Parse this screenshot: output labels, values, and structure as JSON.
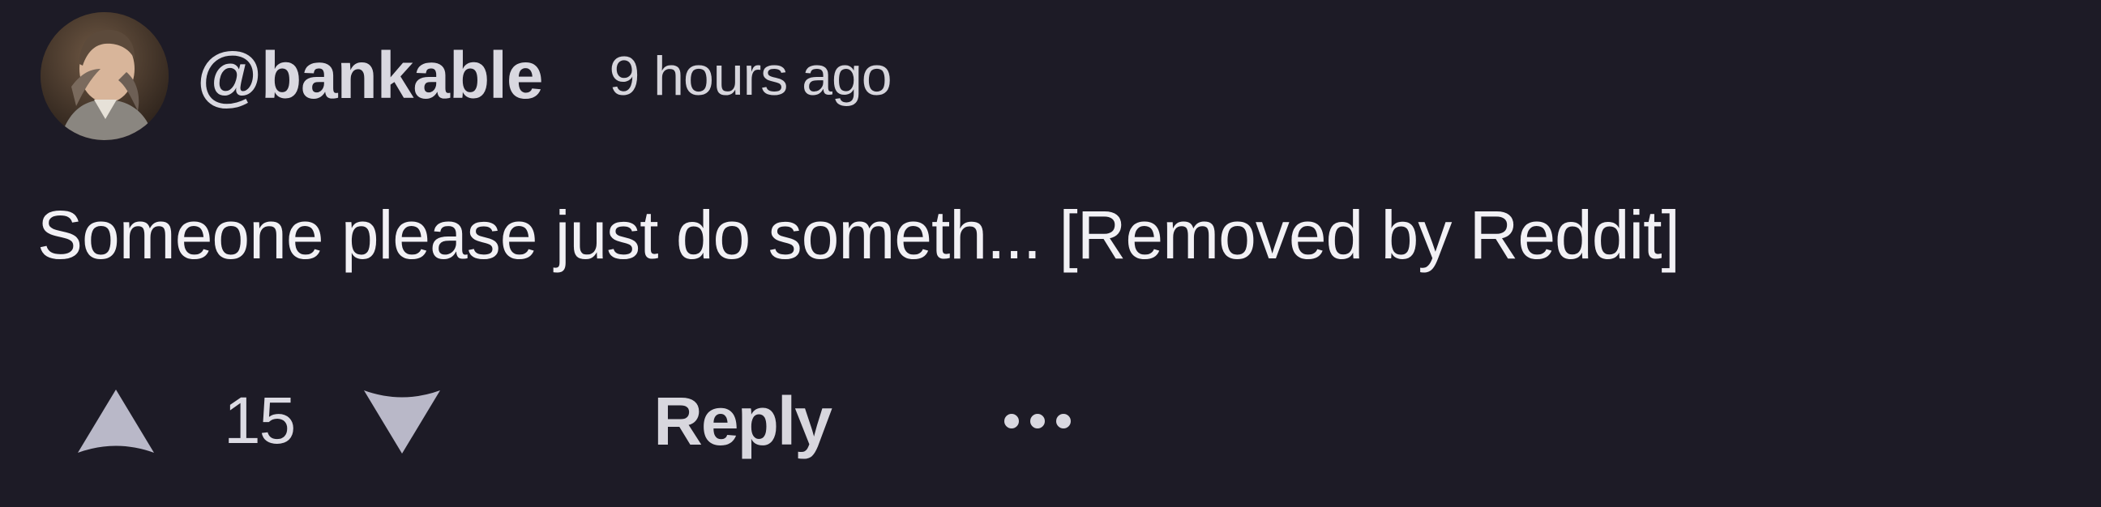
{
  "comment": {
    "username": "@bankable",
    "timestamp": "9 hours ago",
    "text": "Someone please just do someth... [Removed by Reddit]",
    "vote_count": "15",
    "reply_label": "Reply"
  },
  "icons": {
    "upvote": "upvote-arrow-icon",
    "downvote": "downvote-arrow-icon",
    "more": "more-options-icon",
    "avatar": "user-avatar"
  },
  "colors": {
    "background": "#1d1b26",
    "icon": "#b9b8c8",
    "text": "#f2f1f5"
  }
}
